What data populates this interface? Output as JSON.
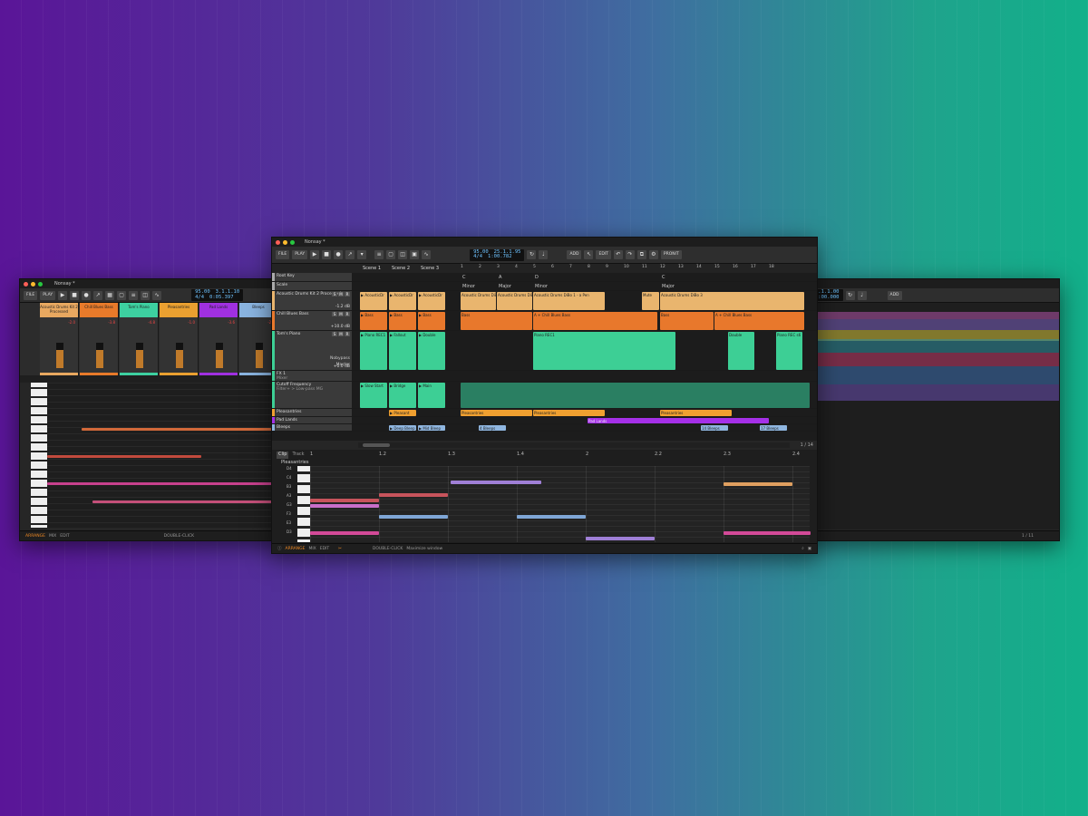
{
  "main": {
    "title": "Nonsay *",
    "toolbar": {
      "file": "FILE",
      "play": "PLAY",
      "add": "ADD",
      "edit": "EDIT",
      "pronit": "PRONIT"
    },
    "transport": {
      "tempo": "95.00",
      "sig": "4/4",
      "pos": "25.1.1.95",
      "time": "1:00.782"
    },
    "scenes": [
      "Scene 1",
      "Scene 2",
      "Scene 3"
    ],
    "ruler": [
      "1",
      "2",
      "3",
      "4",
      "5",
      "6",
      "7",
      "8",
      "9",
      "10",
      "11",
      "12",
      "13",
      "14",
      "15",
      "16",
      "17",
      "18"
    ],
    "tracks": [
      {
        "name": "Root Key"
      },
      {
        "name": "Scale"
      },
      {
        "name": "Acoustic Drums Kit 2 Processed",
        "value": "-1.2 dB"
      },
      {
        "name": "Chill Blues Bass",
        "value": "+10.0 dB"
      },
      {
        "name": "Tom's Piano",
        "value": "+0.0 dB",
        "opt1": "Nobypass",
        "opt2": "Master"
      },
      {
        "name": "FX 1",
        "sub": "Mixer"
      },
      {
        "name": "Cutoff Frequency",
        "sub": "Filter+ > Low-pass MG"
      },
      {
        "name": "Pleasantries"
      },
      {
        "name": "Pad Lands"
      },
      {
        "name": "Bleeps"
      }
    ],
    "key_labels": [
      "C",
      "A",
      "D",
      "C"
    ],
    "scale_labels": [
      "Minor",
      "Major",
      "Minor",
      "Major"
    ],
    "drum_clips": [
      "AcousticDr",
      "AcousticDr",
      "AcousticDr"
    ],
    "drum_arr": [
      "Acoustic Drums DiBo 1 - a Pen",
      "Acoustic Drums DiBo 1 - a Pen",
      "Acoustic Drums DiBo 1 - a Pen",
      "Mute",
      "Acoustic Drums DiBo 3"
    ],
    "bass_clips": [
      "Bass",
      "Bass",
      "Bass"
    ],
    "bass_arr": [
      "Bass",
      "A + Chill Blues Bass",
      "Bass",
      "A + Chill Blues Bass"
    ],
    "piano_clips": [
      "Piano REC1",
      "Fallout",
      "Double"
    ],
    "piano_arr": [
      "Piano REC1",
      "Double",
      "Piano REC s6"
    ],
    "fx_clips": [
      "Slow Start",
      "Bridge",
      "Main"
    ],
    "pleas_clips": [
      "Pleasant",
      "Pleasantries",
      "Pleasantries",
      "Pleasantries"
    ],
    "pad_clip": "Pad Lands",
    "bleep_clips": [
      "Deep Bleep",
      "Mid Bleep",
      "4 Bleeps",
      "14 Bleeps",
      "17 Bleeps"
    ],
    "page": "1 / 14",
    "editor": {
      "tabs": [
        "Clip",
        "Track"
      ],
      "clip_name": "Pleasantries",
      "ruler": [
        "1",
        "1.2",
        "1.3",
        "1.4",
        "2",
        "2.2",
        "2.3",
        "2.4"
      ],
      "keys": [
        "D4",
        "C4",
        "B3",
        "A3",
        "G3",
        "F3",
        "E3",
        "D3"
      ]
    },
    "footer": {
      "arrange": "ARRANGE",
      "mix": "MIX",
      "edit": "EDIT",
      "hint1": "DOUBLE-CLICK",
      "hint2": "Maximize window"
    }
  },
  "left": {
    "title": "Nonsay *",
    "file": "FILE",
    "play": "PLAY",
    "transport": {
      "tempo": "95.00",
      "sig": "4/4",
      "pos": "3.1.1.10",
      "time": "0:05.397"
    },
    "channels": [
      {
        "name": "Acoustic Drums Kit 2 Processed",
        "color": "#e8a860"
      },
      {
        "name": "Chill Blues Bass",
        "color": "#e87a2a"
      },
      {
        "name": "Tom's Piano",
        "color": "#3dd0a0"
      },
      {
        "name": "Pleasantries",
        "color": "#eaa030"
      },
      {
        "name": "Pad Lands",
        "color": "#a030e0"
      },
      {
        "name": "Bleeps",
        "color": "#8ab4e0"
      }
    ],
    "meter_vals": [
      "-2.0",
      "-3.8",
      "-4.8",
      "-1.0",
      "-3.6",
      "-2.0"
    ],
    "footer": {
      "arrange": "ARRANGE",
      "mix": "MIX",
      "edit": "EDIT",
      "hint": "DOUBLE-CLICK"
    }
  },
  "right": {
    "pos": "1.1.1.00",
    "time": "0:00.000",
    "add": "ADD",
    "page": "1 / 11"
  }
}
